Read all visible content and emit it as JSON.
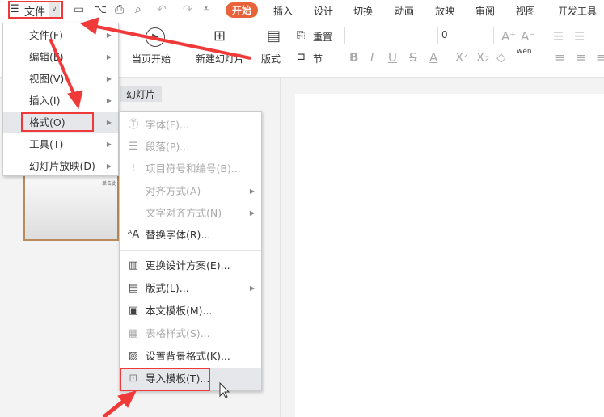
{
  "topbar": {
    "file_menu": "文件",
    "tabs": [
      "开始",
      "插入",
      "设计",
      "切换",
      "动画",
      "放映",
      "审阅",
      "视图",
      "开发工具"
    ]
  },
  "ribbon": {
    "from_current": "当页开始",
    "new_slide": "新建幻灯片",
    "layout": "版式",
    "reset": "重置",
    "section": "节",
    "font_name": "",
    "font_size": "0",
    "phonetic": "wén"
  },
  "panel": {
    "slides_tab": "幻灯片",
    "thumb_text": "单击此"
  },
  "main_menu": [
    {
      "label": "文件(F)"
    },
    {
      "label": "编辑(E)"
    },
    {
      "label": "视图(V)"
    },
    {
      "label": "插入(I)"
    },
    {
      "label": "格式(O)"
    },
    {
      "label": "工具(T)"
    },
    {
      "label": "幻灯片放映(D)"
    }
  ],
  "format_submenu": [
    {
      "label": "字体(F)...",
      "icon": "font-icon",
      "enabled": false
    },
    {
      "label": "段落(P)...",
      "icon": "paragraph-icon",
      "enabled": false
    },
    {
      "label": "项目符号和编号(B)...",
      "icon": "bullets-icon",
      "enabled": false
    },
    {
      "label": "对齐方式(A)",
      "icon": "",
      "enabled": false
    },
    {
      "label": "文字对齐方式(N)",
      "icon": "",
      "enabled": false
    },
    {
      "label": "替换字体(R)...",
      "icon": "replace-font-icon",
      "enabled": true
    },
    {
      "label": "更换设计方案(E)...",
      "icon": "design-icon",
      "enabled": true
    },
    {
      "label": "版式(L)...",
      "icon": "layout-icon",
      "enabled": true
    },
    {
      "label": "本文模板(M)...",
      "icon": "template-icon",
      "enabled": true
    },
    {
      "label": "表格样式(S)...",
      "icon": "table-style-icon",
      "enabled": false
    },
    {
      "label": "设置背景格式(K)...",
      "icon": "background-icon",
      "enabled": true
    },
    {
      "label": "导入模板(T)...",
      "icon": "import-template-icon",
      "enabled": true
    }
  ],
  "colors": {
    "accent": "#e8623a",
    "annotation": "#f03a3a"
  }
}
